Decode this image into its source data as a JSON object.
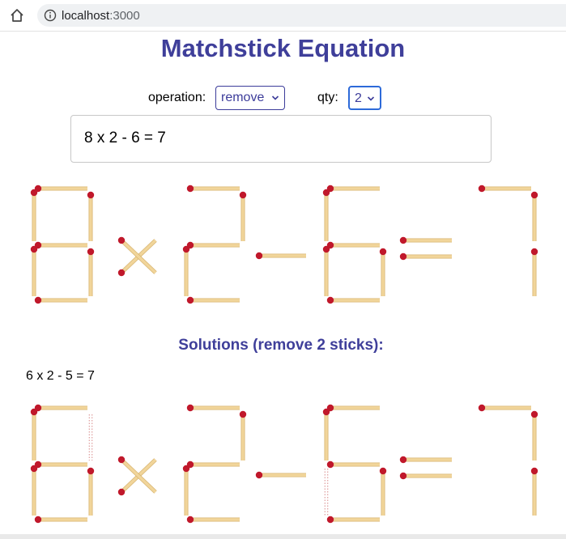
{
  "browser": {
    "url_host": "localhost",
    "url_port": ":3000"
  },
  "page": {
    "title": "Matchstick Equation"
  },
  "controls": {
    "operation_label": "operation:",
    "operation_value": "remove",
    "qty_label": "qty:",
    "qty_value": "2"
  },
  "equation_input": {
    "value": "8 x 2 - 6 = 7"
  },
  "solutions": {
    "heading": "Solutions (remove 2 sticks):",
    "items": [
      {
        "equation": "6 x 2 - 5 = 7"
      }
    ]
  },
  "colors": {
    "title": "#3f3f9a",
    "stick": "#f1d59a",
    "match_head": "#c0182b",
    "removed_outline": "#d88a8a"
  },
  "icons": [
    "home-icon",
    "info-icon",
    "chevron-down-icon"
  ]
}
